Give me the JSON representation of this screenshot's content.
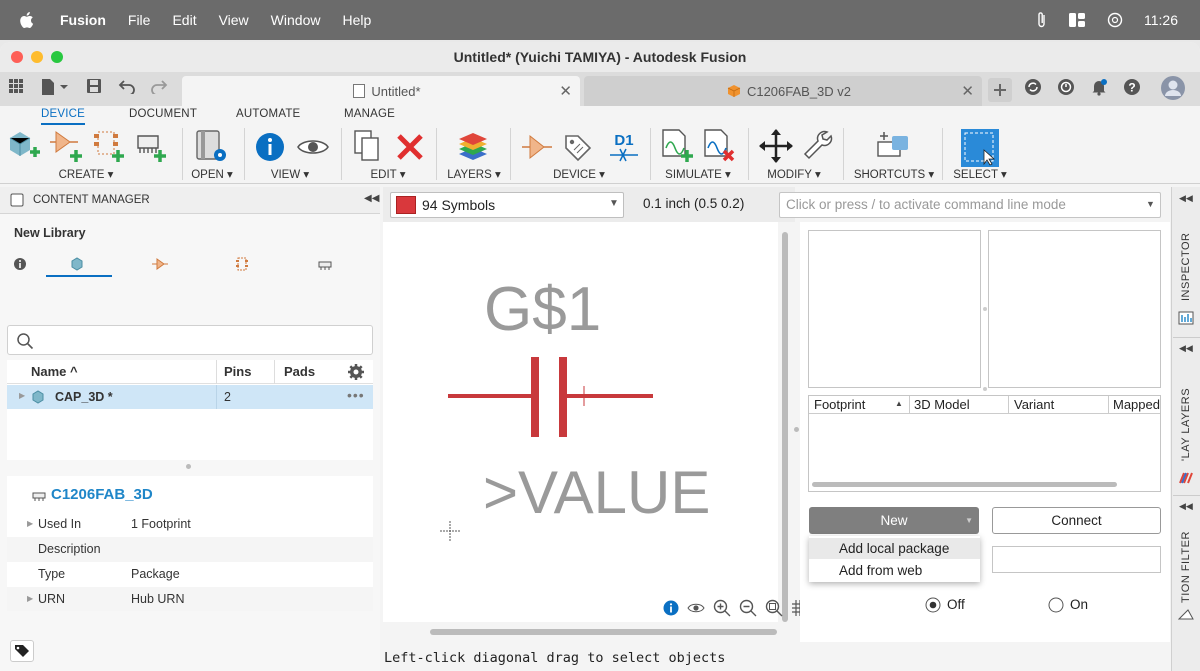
{
  "menubar": {
    "app": "Fusion",
    "items": [
      "File",
      "Edit",
      "View",
      "Window",
      "Help"
    ],
    "clock": "11:26"
  },
  "window": {
    "title": "Untitled* (Yuichi TAMIYA) - Autodesk Fusion"
  },
  "tabs": [
    {
      "label": "Untitled*"
    },
    {
      "label": "C1206FAB_3D v2"
    }
  ],
  "ribbon": {
    "tabs": [
      "DEVICE",
      "DOCUMENT",
      "AUTOMATE",
      "MANAGE"
    ],
    "groups": {
      "create": "CREATE ▾",
      "open": "OPEN ▾",
      "view": "VIEW ▾",
      "edit": "EDIT ▾",
      "layers": "LAYERS ▾",
      "device": "DEVICE ▾",
      "simulate": "SIMULATE ▾",
      "modify": "MODIFY ▾",
      "shortcuts": "SHORTCUTS ▾",
      "select": "SELECT ▾"
    },
    "d1_label": "D1"
  },
  "content_manager": {
    "header": "CONTENT MANAGER",
    "library": "New Library",
    "table": {
      "col_name": "Name ^",
      "col_pins": "Pins",
      "col_pads": "Pads",
      "row": {
        "name": "CAP_3D *",
        "pins": "2",
        "pads": ""
      }
    },
    "details": {
      "title": "C1206FAB_3D",
      "rows": [
        {
          "label": "Used In",
          "value": "1 Footprint"
        },
        {
          "label": "Description",
          "value": ""
        },
        {
          "label": "Type",
          "value": "Package"
        },
        {
          "label": "URN",
          "value": "Hub URN"
        }
      ]
    }
  },
  "toolbar": {
    "symbols": "94 Symbols",
    "grid": "0.1 inch (0.5 0.2)",
    "command_placeholder": "Click or press / to activate command line mode"
  },
  "canvas": {
    "name_text": "G$1",
    "value_text": ">VALUE"
  },
  "right_panel": {
    "columns": [
      "Footprint",
      "3D Model",
      "Variant",
      "Mapped"
    ],
    "new_button": "New",
    "connect_button": "Connect",
    "dropdown": [
      "Add local package",
      "Add from web"
    ],
    "radio_off": "Off",
    "radio_on": "On"
  },
  "vtabs": [
    "INSPECTOR",
    "'LAY LAYERS",
    "TION FILTER"
  ],
  "status": "Left-click diagonal drag to select objects",
  "colors": {
    "accent": "#0a6fc2",
    "symbol_red": "#c8393c",
    "new_button": "#7f7f7f"
  }
}
